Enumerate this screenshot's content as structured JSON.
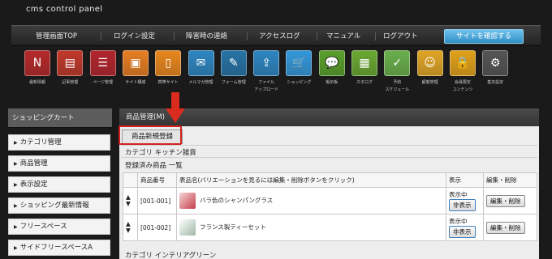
{
  "app_title": "cms control panel",
  "topnav": {
    "items": [
      "管理画面TOP",
      "ログイン設定",
      "障害時の連絡",
      "アクセスログ",
      "マニュアル",
      "ログアウト"
    ],
    "site_button": "サイトを確認する"
  },
  "icons": [
    {
      "label": "最新情報",
      "icon": "news-icon",
      "color": "#b52a2a",
      "glyph": "N"
    },
    {
      "label": "記事管理",
      "icon": "article-icon",
      "color": "#c0392b",
      "glyph": "▤"
    },
    {
      "label": "ページ管理",
      "icon": "page-list-icon",
      "color": "#b3262e",
      "glyph": "☰"
    },
    {
      "label": "サイト構成",
      "icon": "site-structure-icon",
      "color": "#e67e22",
      "glyph": "▣"
    },
    {
      "label": "携帯サイト",
      "icon": "mobile-site-icon",
      "color": "#e8871e",
      "glyph": "▯"
    },
    {
      "label": "メルマガ管理",
      "icon": "mail-magazine-icon",
      "color": "#2e86c1",
      "glyph": "✉"
    },
    {
      "label": "フォーム管理",
      "icon": "form-icon",
      "color": "#2874a6",
      "glyph": "✎"
    },
    {
      "label": "ファイル\nアップロード",
      "icon": "file-upload-icon",
      "color": "#2e86c1",
      "glyph": "⇪"
    },
    {
      "label": "ショッピング",
      "icon": "shopping-cart-icon",
      "color": "#3498db",
      "glyph": "🛒"
    },
    {
      "label": "掲示板",
      "icon": "bulletin-board-icon",
      "color": "#5aa02c",
      "glyph": "💬"
    },
    {
      "label": "カタログ",
      "icon": "catalog-icon",
      "color": "#6aa832",
      "glyph": "▦"
    },
    {
      "label": "予約\nスケジュール",
      "icon": "schedule-icon",
      "color": "#6ab04c",
      "glyph": "✓"
    },
    {
      "label": "顧客管理",
      "icon": "customer-icon",
      "color": "#e0a526",
      "glyph": "☺"
    },
    {
      "label": "会員限定\nコンテンツ",
      "icon": "members-lock-icon",
      "color": "#e1a21b",
      "glyph": "🔒"
    },
    {
      "label": "基本設定",
      "icon": "gear-icon",
      "color": "#555555",
      "glyph": "⚙"
    }
  ],
  "sidebar": {
    "title": "ショッピングカート",
    "items": [
      "カテゴリ管理",
      "商品管理",
      "表示設定",
      "ショッピング最新情報",
      "フリースペース",
      "サイドフリースペースA"
    ]
  },
  "main": {
    "title": "商品管理(M)",
    "new_button": "商品新規登録",
    "category1": "カテゴリ  キッチン雑貨",
    "registered_label": "登録済み商品  一覧",
    "columns": [
      "",
      "商品番号",
      "表品名(バリエーションを見るには編集・削除ボタンをクリック)",
      "表示",
      "編集・削除"
    ],
    "rows": [
      {
        "code": "[001-001]",
        "name": "バラ色のシャンパングラス",
        "status": "表示中",
        "toggle": "非表示",
        "edit": "編集・削除"
      },
      {
        "code": "[001-002]",
        "name": "フランス製ティーセット",
        "status": "表示中",
        "toggle": "非表示",
        "edit": "編集・削除"
      }
    ],
    "category2": "カテゴリ  インテリアグリーン"
  }
}
